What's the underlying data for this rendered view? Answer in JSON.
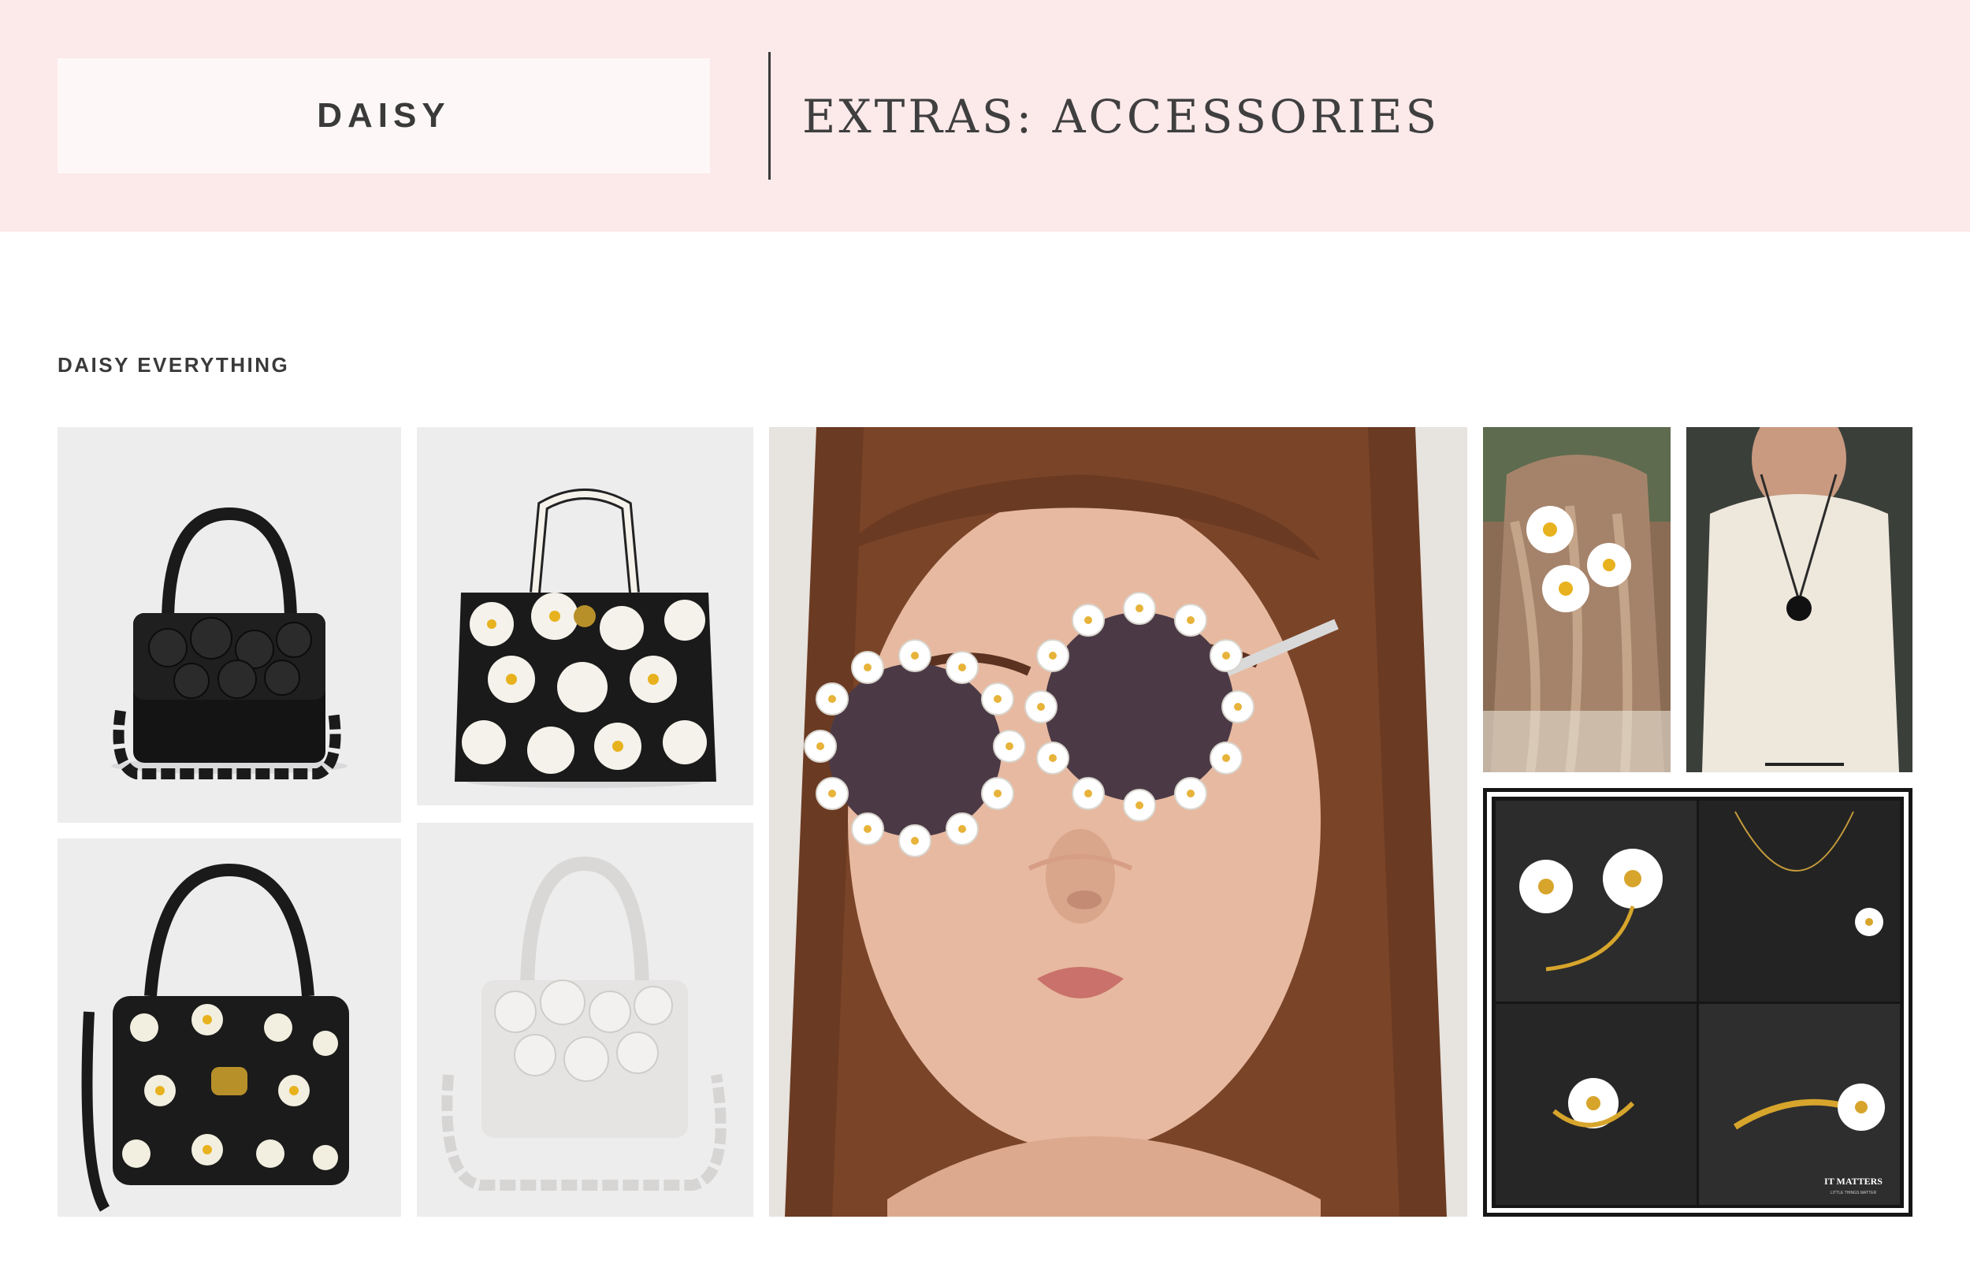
{
  "header": {
    "brand": "DAISY",
    "section_title": "EXTRAS: ACCESSORIES"
  },
  "gallery": {
    "heading": "DAISY EVERYTHING",
    "jewelry_watermark": "IT MATTERS",
    "jewelry_watermark_sub": "LITTLE THINGS MATTER"
  }
}
